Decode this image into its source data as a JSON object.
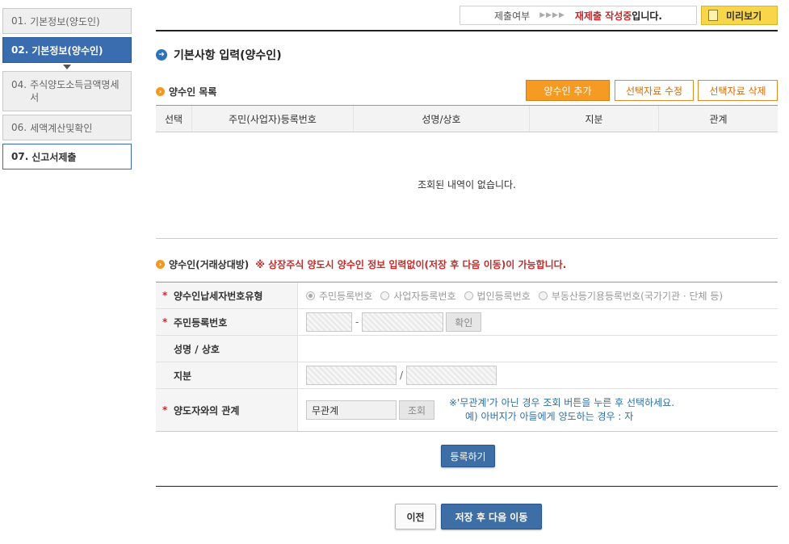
{
  "sidebar": {
    "steps": [
      {
        "num": "01.",
        "label": "기본정보(양도인)"
      },
      {
        "num": "02.",
        "label": "기본정보(양수인)"
      },
      {
        "num": "04.",
        "label": "주식양도소득금액명세서"
      },
      {
        "num": "06.",
        "label": "세액계산및확인"
      },
      {
        "num": "07.",
        "label": "신고서제출"
      }
    ]
  },
  "status": {
    "label": "제출여부",
    "arrows": "▶▶▶▶",
    "value_red": "재제출 작성중",
    "value_suffix": "입니다."
  },
  "preview_label": "미리보기",
  "section_title": "기본사항 입력(양수인)",
  "list": {
    "title": "양수인 목록",
    "add_label": "양수인 추가",
    "edit_label": "선택자료 수정",
    "delete_label": "선택자료 삭제",
    "columns": [
      "선택",
      "주민(사업자)등록번호",
      "성명/상호",
      "지분",
      "관계"
    ],
    "empty_message": "조회된 내역이 없습니다."
  },
  "counterparty": {
    "title": "양수인(거래상대방)",
    "warning": "※ 상장주식 양도시 양수인 정보 입력없이(저장 후 다음 이동)이 가능합니다."
  },
  "form": {
    "type_label": "양수인납세자번호유형",
    "type_options": [
      "주민등록번호",
      "사업자등록번호",
      "법인등록번호",
      "부동산등기용등록번호(국가기관 · 단체 등)"
    ],
    "id_label": "주민등록번호",
    "id_sep": "-",
    "confirm_label": "확인",
    "name_label": "성명 / 상호",
    "share_label": "지분",
    "share_sep": "/",
    "relation_label": "양도자와의 관계",
    "relation_value": "무관계",
    "lookup_label": "조회",
    "note_line1": "※'무관계'가 아닌 경우 조회 버튼을 누른 후 선택하세요.",
    "note_line2": "예) 아버지가 아들에게 양도하는 경우 : 자"
  },
  "register_label": "등록하기",
  "prev_label": "이전",
  "next_label": "저장 후 다음 이동",
  "colors": {
    "accent_blue": "#3a6cb0",
    "orange": "#f59a23",
    "warning_red": "#c62b2b",
    "preview_yellow": "#f7d64a"
  }
}
